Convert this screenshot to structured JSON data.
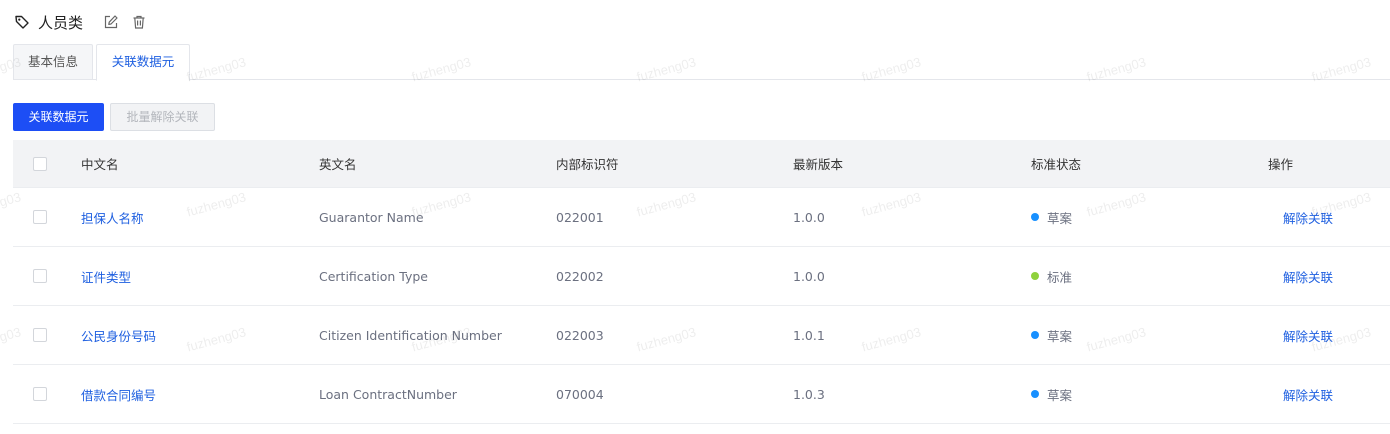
{
  "header": {
    "title": "人员类"
  },
  "tabs": [
    {
      "label": "基本信息",
      "active": false
    },
    {
      "label": "关联数据元",
      "active": true
    }
  ],
  "toolbar": {
    "link_button": "关联数据元",
    "batch_unlink_button": "批量解除关联"
  },
  "table": {
    "columns": [
      "中文名",
      "英文名",
      "内部标识符",
      "最新版本",
      "标准状态",
      "操作"
    ],
    "rows": [
      {
        "cn_name": "担保人名称",
        "en_name": "Guarantor Name",
        "identifier": "022001",
        "version": "1.0.0",
        "status": "草案",
        "status_color": "#1890ff",
        "action": "解除关联"
      },
      {
        "cn_name": "证件类型",
        "en_name": "Certification Type",
        "identifier": "022002",
        "version": "1.0.0",
        "status": "标准",
        "status_color": "#8fd13c",
        "action": "解除关联"
      },
      {
        "cn_name": "公民身份号码",
        "en_name": "Citizen Identification Number",
        "identifier": "022003",
        "version": "1.0.1",
        "status": "草案",
        "status_color": "#1890ff",
        "action": "解除关联"
      },
      {
        "cn_name": "借款合同编号",
        "en_name": "Loan ContractNumber",
        "identifier": "070004",
        "version": "1.0.3",
        "status": "草案",
        "status_color": "#1890ff",
        "action": "解除关联"
      }
    ]
  },
  "watermark": {
    "text": "fuzheng03"
  },
  "colors": {
    "primary": "#1d4ef5",
    "link": "#1e5fe0",
    "header_bg": "#f2f3f5"
  }
}
